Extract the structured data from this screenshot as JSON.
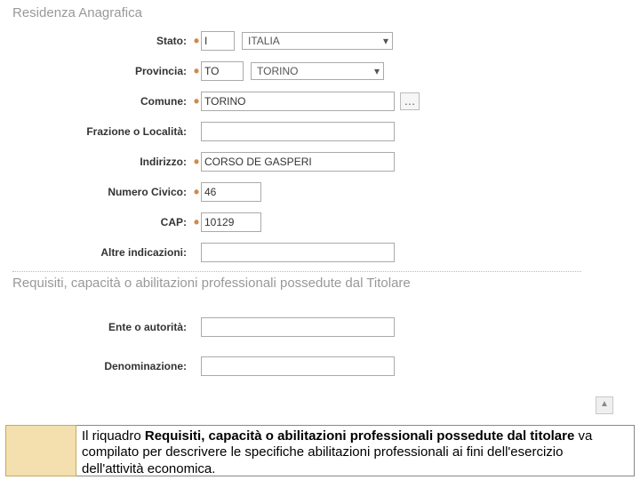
{
  "section1_title": "Residenza Anagrafica",
  "fields": {
    "stato": {
      "label": "Stato:",
      "required": true,
      "value": "I",
      "select": "ITALIA"
    },
    "provincia": {
      "label": "Provincia:",
      "required": true,
      "value": "TO",
      "select": "TORINO"
    },
    "comune": {
      "label": "Comune:",
      "required": true,
      "value": "TORINO"
    },
    "frazione": {
      "label": "Frazione o Località:",
      "required": false,
      "value": ""
    },
    "indirizzo": {
      "label": "Indirizzo:",
      "required": true,
      "value": "CORSO DE GASPERI"
    },
    "numero_civico": {
      "label": "Numero Civico:",
      "required": true,
      "value": "46"
    },
    "cap": {
      "label": "CAP:",
      "required": true,
      "value": "10129"
    },
    "altre": {
      "label": "Altre indicazioni:",
      "required": false,
      "value": ""
    }
  },
  "section2_title": "Requisiti, capacità o abilitazioni professionali possedute dal Titolare",
  "fields2": {
    "ente": {
      "label": "Ente o autorità:",
      "required": false,
      "value": ""
    },
    "denominazione": {
      "label": "Denominazione:",
      "required": false,
      "value": ""
    }
  },
  "lookup_glyph": "…",
  "scroll_glyph": "▲",
  "caret_glyph": "▾",
  "instruction": {
    "prefix": "Il riquadro ",
    "bold": "Requisiti, capacità o abilitazioni professionali possedute dal titolare",
    "rest": "  va compilato per descrivere le specifiche abilitazioni professionali ai fini dell'esercizio dell'attività economica."
  }
}
